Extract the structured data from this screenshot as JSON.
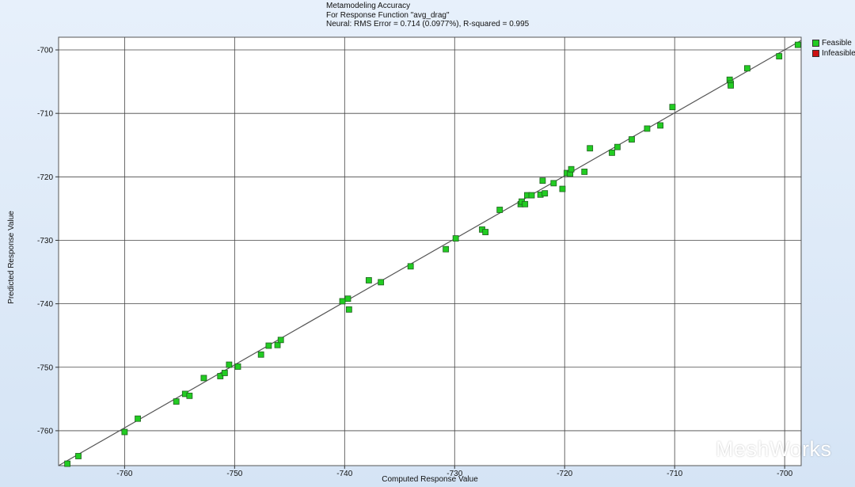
{
  "title_lines": [
    "Metamodeling Accuracy",
    "For Response Function \"avg_drag\"",
    "Neural: RMS Error = 0.714 (0.0977%),  R-squared = 0.995"
  ],
  "legend": {
    "feasible": "Feasible",
    "infeasible": "Infeasible"
  },
  "colors": {
    "feasible": "#22cc22",
    "infeasible": "#cc1111",
    "fit_line": "#555555",
    "grid": "#444444"
  },
  "watermark": "MeshWorks",
  "chart_data": {
    "type": "scatter",
    "xlabel": "Computed Response Value",
    "ylabel": "Predicted Response Value",
    "xlim": [
      -766,
      -698.5
    ],
    "ylim": [
      -765.5,
      -698
    ],
    "xticks": [
      -760,
      -750,
      -740,
      -730,
      -720,
      -710,
      -700
    ],
    "yticks": [
      -700,
      -710,
      -720,
      -730,
      -740,
      -750,
      -760
    ],
    "xtick_labels": [
      "-760",
      "-750",
      "-740",
      "-730",
      "-720",
      "-710",
      "-700"
    ],
    "ytick_labels": [
      "-700",
      "-710",
      "-720",
      "-730",
      "-740",
      "-750",
      "-760"
    ],
    "grid": true,
    "legend_position": "top-right",
    "fit_line": [
      [
        -766,
        -765.5
      ],
      [
        -698.5,
        -698.5
      ]
    ],
    "series": [
      {
        "name": "Feasible",
        "points": [
          [
            -765.2,
            -765.2
          ],
          [
            -764.2,
            -764.0
          ],
          [
            -760.0,
            -760.2
          ],
          [
            -758.8,
            -758.1
          ],
          [
            -755.3,
            -755.4
          ],
          [
            -754.5,
            -754.2
          ],
          [
            -754.1,
            -754.5
          ],
          [
            -752.8,
            -751.7
          ],
          [
            -751.3,
            -751.4
          ],
          [
            -750.9,
            -750.9
          ],
          [
            -750.5,
            -749.6
          ],
          [
            -749.7,
            -749.9
          ],
          [
            -747.6,
            -748.0
          ],
          [
            -746.9,
            -746.6
          ],
          [
            -746.1,
            -746.5
          ],
          [
            -745.8,
            -745.7
          ],
          [
            -740.2,
            -739.6
          ],
          [
            -739.7,
            -739.2
          ],
          [
            -739.6,
            -740.9
          ],
          [
            -737.8,
            -736.3
          ],
          [
            -736.7,
            -736.6
          ],
          [
            -734.0,
            -734.1
          ],
          [
            -730.8,
            -731.4
          ],
          [
            -729.9,
            -729.7
          ],
          [
            -727.5,
            -728.3
          ],
          [
            -727.2,
            -728.7
          ],
          [
            -725.9,
            -725.2
          ],
          [
            -724.0,
            -724.3
          ],
          [
            -723.9,
            -723.9
          ],
          [
            -723.6,
            -724.3
          ],
          [
            -723.4,
            -722.9
          ],
          [
            -723.0,
            -722.9
          ],
          [
            -722.2,
            -722.8
          ],
          [
            -721.8,
            -722.6
          ],
          [
            -722.0,
            -720.6
          ],
          [
            -721.0,
            -721.0
          ],
          [
            -720.2,
            -721.9
          ],
          [
            -719.8,
            -719.4
          ],
          [
            -719.5,
            -719.5
          ],
          [
            -719.4,
            -718.8
          ],
          [
            -718.2,
            -719.2
          ],
          [
            -717.7,
            -715.5
          ],
          [
            -715.7,
            -716.2
          ],
          [
            -715.2,
            -715.3
          ],
          [
            -713.9,
            -714.1
          ],
          [
            -712.5,
            -712.4
          ],
          [
            -711.3,
            -711.9
          ],
          [
            -710.2,
            -709.0
          ],
          [
            -705.0,
            -704.7
          ],
          [
            -704.9,
            -705.3
          ],
          [
            -704.9,
            -705.6
          ],
          [
            -703.4,
            -702.9
          ],
          [
            -700.5,
            -701.0
          ],
          [
            -698.8,
            -699.2
          ]
        ]
      },
      {
        "name": "Infeasible",
        "points": []
      }
    ]
  }
}
